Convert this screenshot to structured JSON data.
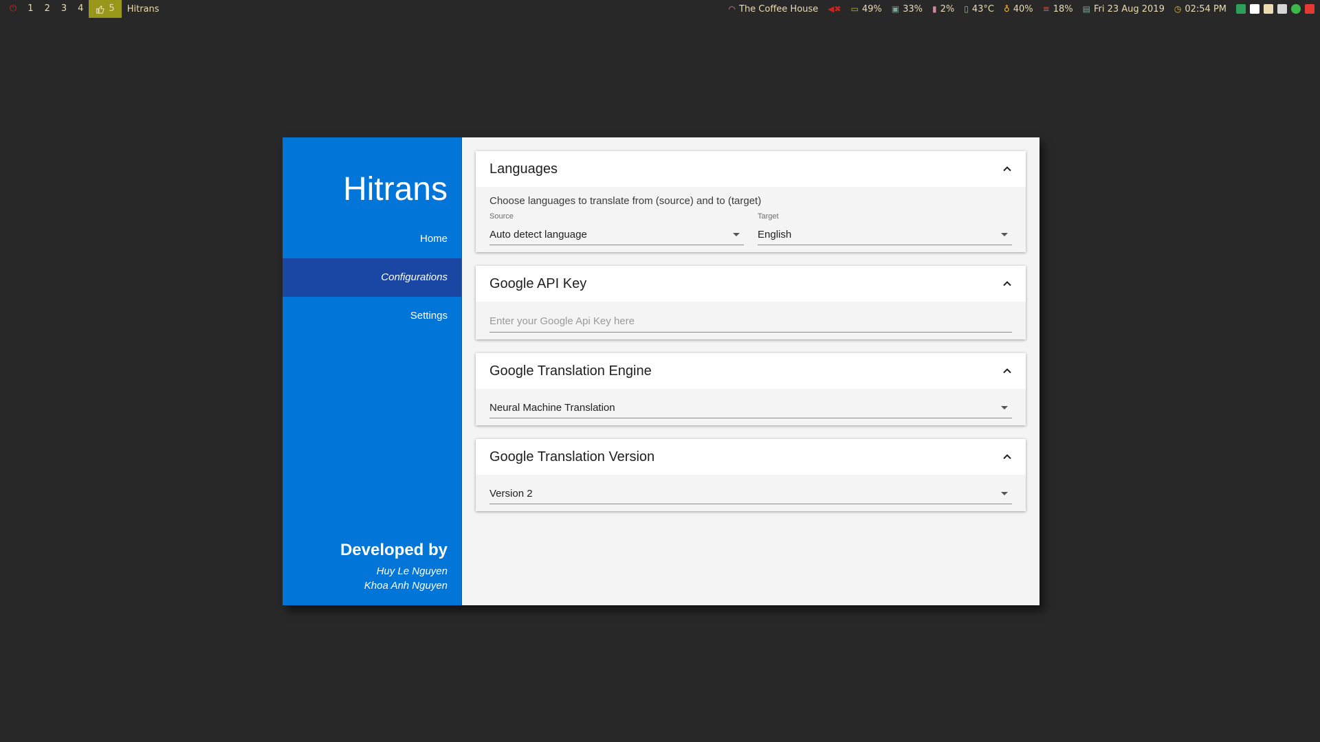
{
  "topbar": {
    "workspaces": [
      "1",
      "2",
      "3",
      "4"
    ],
    "active_workspace": "5",
    "window_title": "Hitrans",
    "wifi": "The Coffee House",
    "battery": "49%",
    "disk": "33%",
    "memory": "2%",
    "temperature": "43°C",
    "brightness": "40%",
    "cpu": "18%",
    "date": "Fri 23 Aug 2019",
    "time": "02:54 PM"
  },
  "sidebar": {
    "brand": "Hitrans",
    "nav": [
      {
        "label": "Home"
      },
      {
        "label": "Configurations"
      },
      {
        "label": "Settings"
      }
    ],
    "credits_heading": "Developed by",
    "credits": [
      "Huy Le Nguyen",
      "Khoa Anh Nguyen"
    ]
  },
  "languages": {
    "title": "Languages",
    "description": "Choose languages to translate from (source) and to (target)",
    "source_label": "Source",
    "source_value": "Auto detect language",
    "target_label": "Target",
    "target_value": "English"
  },
  "api_key": {
    "title": "Google API Key",
    "placeholder": "Enter your Google Api Key here"
  },
  "engine": {
    "title": "Google Translation Engine",
    "value": "Neural Machine Translation"
  },
  "version": {
    "title": "Google Translation Version",
    "value": "Version 2"
  },
  "colors": {
    "sidebar": "#0275d8",
    "sidebar_active": "#1a47a3",
    "workspace_active": "#98971a"
  }
}
